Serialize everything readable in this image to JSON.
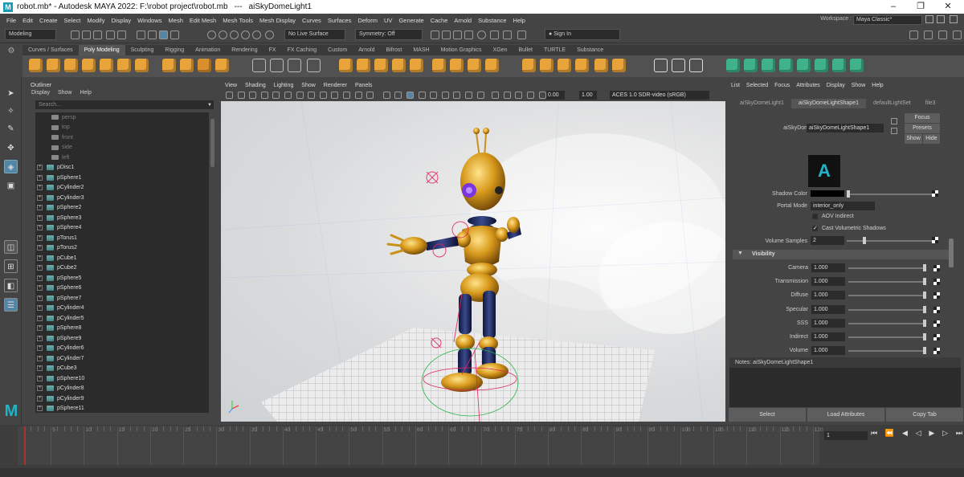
{
  "titlebar": {
    "tab_title": "robot.mb*",
    "app_title": "robot.mb* - Autodesk MAYA 2022: F:\\robot project\\robot.mb",
    "separator": "---",
    "node": "aiSkyDomeLight1"
  },
  "menubar": {
    "items": [
      "File",
      "Edit",
      "Create",
      "Select",
      "Modify",
      "Display",
      "Windows",
      "Mesh",
      "Edit Mesh",
      "Mesh Tools",
      "Mesh Display",
      "Curves",
      "Surfaces",
      "Deform",
      "UV",
      "Generate",
      "Cache",
      "Arnold",
      "Substance",
      "Help"
    ],
    "workspace_label": "Workspace :",
    "workspace_value": "Maya Classic*"
  },
  "statusline": {
    "mode": "Modeling",
    "live_surface": "No Live Surface",
    "symmetry": "Symmetry: Off",
    "signin": "Sign In"
  },
  "shelf": {
    "tabs": [
      "Curves / Surfaces",
      "Poly Modeling",
      "Sculpting",
      "Rigging",
      "Animation",
      "Rendering",
      "FX",
      "FX Caching",
      "Custom",
      "Arnold",
      "Bifrost",
      "MASH",
      "Motion Graphics",
      "XGen",
      "Bullet",
      "TURTLE",
      "Substance"
    ],
    "active_tab": "Poly Modeling"
  },
  "outliner": {
    "title": "Outliner",
    "menu": [
      "Display",
      "Show",
      "Help"
    ],
    "search_placeholder": "Search...",
    "cameras": [
      "persp",
      "top",
      "front",
      "side",
      "left"
    ],
    "items": [
      "pDisc1",
      "pSphere1",
      "pCylinder2",
      "pCylinder3",
      "pSphere2",
      "pSphere3",
      "pSphere4",
      "pTorus1",
      "pTorus2",
      "pCube1",
      "pCube2",
      "pSphere5",
      "pSphere6",
      "pSphere7",
      "pCylinder4",
      "pCylinder5",
      "pSphere8",
      "pSphere9",
      "pCylinder6",
      "pCylinder7",
      "pCube3",
      "pSphere10",
      "pCylinder8",
      "pCylinder9",
      "pSphere11"
    ]
  },
  "viewport": {
    "menu": [
      "View",
      "Shading",
      "Lighting",
      "Show",
      "Renderer",
      "Panels"
    ],
    "exposure": "0.00",
    "gamma": "1.00",
    "colorspace": "ACES 1.0 SDR-video (sRGB)"
  },
  "attr": {
    "menu": [
      "List",
      "Selected",
      "Focus",
      "Attributes",
      "Display",
      "Show",
      "Help"
    ],
    "tabs": [
      "aiSkyDomeLight1",
      "aiSkyDomeLightShape1",
      "defaultLightSet",
      "file3"
    ],
    "active_tab": "aiSkyDomeLightShape1",
    "node_label": "aiSkyDomeLight:",
    "node_value": "aiSkyDomeLightShape1",
    "focus": "Focus",
    "presets": "Presets",
    "show": "Show",
    "hide": "Hide",
    "shadow_color": "Shadow Color",
    "portal_mode_label": "Portal Mode",
    "portal_mode": "interior_only",
    "aov_indirect": "AOV Indirect",
    "cast_volumetric": "Cast Volumetric Shadows",
    "volume_samples_label": "Volume Samples",
    "volume_samples": "2",
    "visibility_section": "Visibility",
    "visibility": [
      {
        "label": "Camera",
        "value": "1.000"
      },
      {
        "label": "Transmission",
        "value": "1.000"
      },
      {
        "label": "Diffuse",
        "value": "1.000"
      },
      {
        "label": "Specular",
        "value": "1.000"
      },
      {
        "label": "SSS",
        "value": "1.000"
      },
      {
        "label": "Indirect",
        "value": "1.000"
      },
      {
        "label": "Volume",
        "value": "1.000"
      }
    ],
    "notes": "Notes:  aiSkyDomeLightShape1",
    "buttons": [
      "Select",
      "Load Attributes",
      "Copy Tab"
    ]
  },
  "timeline": {
    "ticks": [
      "5",
      "10",
      "15",
      "20",
      "25",
      "30",
      "35",
      "40",
      "45",
      "50",
      "55",
      "60",
      "65",
      "70",
      "75",
      "80",
      "85",
      "90",
      "95",
      "100",
      "105",
      "110",
      "115",
      "120"
    ],
    "current_frame": "1"
  },
  "colors": {
    "accent": "#5285a6",
    "shelf_orange": "#e8a33a",
    "shelf_green": "#3fb28a"
  }
}
